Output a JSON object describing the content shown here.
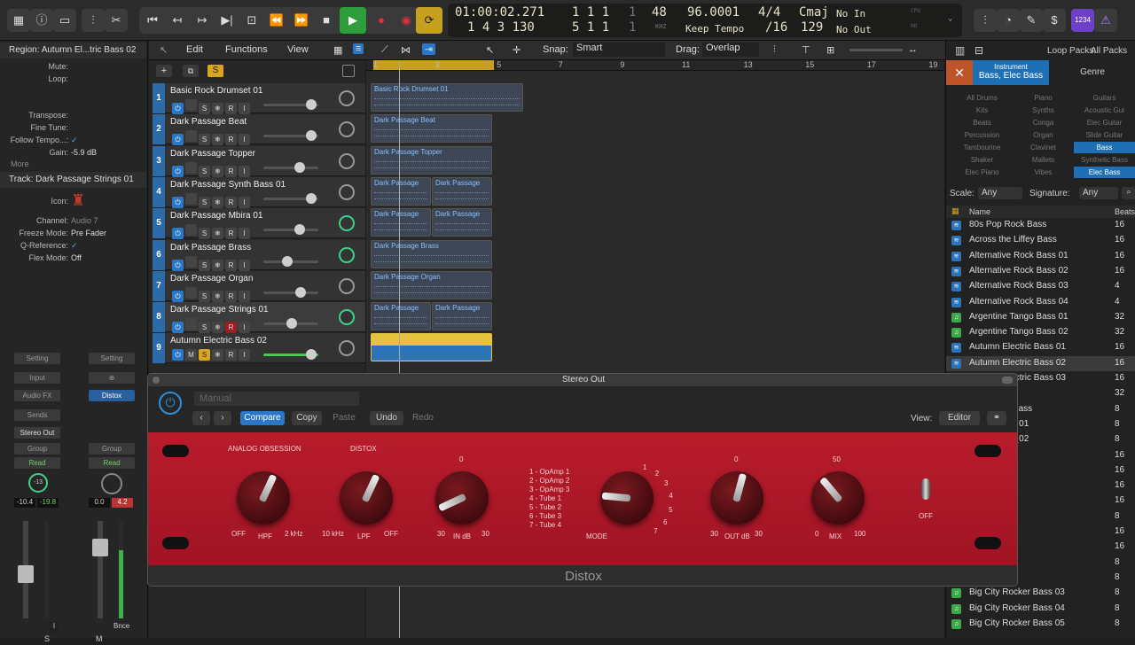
{
  "lcd": {
    "time": "01:00:02.271",
    "bars": "1  1  1",
    "bars_sub": "1",
    "beats": "1  4  3  130",
    "beats2": "5  1  1",
    "beats2_sub": "1",
    "tempo_small": "48",
    "tempo_small_sub": "KHZ",
    "tempo": "96.0001",
    "tempo_mode": "Keep Tempo",
    "sig": "4/4",
    "sig_div": "/16",
    "key": "Cmaj",
    "key_num": "129",
    "in": "No In",
    "out": "No Out",
    "cpu": "CPU",
    "hd": "HD"
  },
  "toolbar": {
    "edit": "Edit",
    "functions": "Functions",
    "view": "View",
    "snap_label": "Snap:",
    "snap": "Smart",
    "drag_label": "Drag:",
    "drag": "Overlap"
  },
  "inspector": {
    "region_title": "Region: Autumn El...tric Bass 02",
    "mute": "Mute:",
    "loop": "Loop:",
    "transpose": "Transpose:",
    "finetune": "Fine Tune:",
    "follow": "Follow Tempo...:",
    "gain_label": "Gain:",
    "gain": "-5.9 dB",
    "more": "More",
    "track_title": "Track:  Dark Passage Strings 01",
    "icon": "Icon:",
    "channel": "Channel:",
    "channel_val": "Audio 7",
    "freeze": "Freeze Mode:",
    "freeze_val": "Pre Fader",
    "qref": "Q-Reference:",
    "flex": "Flex Mode:",
    "flex_val": "Off"
  },
  "strips": [
    {
      "setting": "Setting",
      "input": "Input",
      "fx": "Audio FX",
      "sends": "Sends",
      "out": "Stereo Out",
      "group": "Group",
      "auto": "Read",
      "vol": "-10.4",
      "peak": "-19.8",
      "pan": "-13",
      "mode": "I",
      "bottom": "S"
    },
    {
      "setting": "Setting",
      "input": "",
      "fx": "Distox",
      "sends": "",
      "out": "",
      "group": "Group",
      "auto": "Read",
      "vol": "0.0",
      "peak": "4.2",
      "pan": "",
      "mode": "Bnce",
      "bottom": "M"
    }
  ],
  "tracks": [
    {
      "n": "1",
      "name": "Basic Rock Drumset 01",
      "fader": 0.85
    },
    {
      "n": "2",
      "name": "Dark Passage Beat",
      "fader": 0.85
    },
    {
      "n": "3",
      "name": "Dark Passage Topper",
      "fader": 0.62
    },
    {
      "n": "4",
      "name": "Dark Passage Synth Bass 01",
      "fader": 0.85
    },
    {
      "n": "5",
      "name": "Dark Passage Mbira 01",
      "fader": 0.62
    },
    {
      "n": "6",
      "name": "Dark Passage Brass",
      "fader": 0.37
    },
    {
      "n": "7",
      "name": "Dark Passage Organ",
      "fader": 0.65
    },
    {
      "n": "8",
      "name": "Dark Passage Strings 01",
      "fader": 0.47
    },
    {
      "n": "9",
      "name": "Autumn Electric Bass 02",
      "fader": 0.85
    }
  ],
  "track_buttons": {
    "mute": "M",
    "solo": "S",
    "freeze": "❄",
    "rec": "R",
    "input": "I"
  },
  "ruler": [
    "1",
    "3",
    "5",
    "7",
    "9",
    "11",
    "13",
    "15",
    "17",
    "19"
  ],
  "regions": [
    {
      "row": 0,
      "label": "Basic Rock Drumset 01",
      "x": 5,
      "w": 172
    },
    {
      "row": 1,
      "label": "Dark Passage Beat",
      "x": 5,
      "w": 137
    },
    {
      "row": 2,
      "label": "Dark Passage Topper",
      "x": 5,
      "w": 137
    },
    {
      "row": 3,
      "label": "Dark Passage",
      "x": 5,
      "w": 68
    },
    {
      "row": 3,
      "label": "Dark Passage",
      "x": 74,
      "w": 68
    },
    {
      "row": 4,
      "label": "Dark Passage",
      "x": 5,
      "w": 68
    },
    {
      "row": 4,
      "label": "Dark Passage",
      "x": 74,
      "w": 68
    },
    {
      "row": 5,
      "label": "Dark Passage Brass",
      "x": 5,
      "w": 137
    },
    {
      "row": 6,
      "label": "Dark Passage Organ",
      "x": 5,
      "w": 137
    },
    {
      "row": 7,
      "label": "Dark Passage",
      "x": 5,
      "w": 68
    },
    {
      "row": 7,
      "label": "Dark Passage",
      "x": 74,
      "w": 68
    },
    {
      "row": 8,
      "label": "Autumn Electric Bass 02",
      "x": 5,
      "w": 137,
      "sel": true
    }
  ],
  "browser": {
    "loop_packs_label": "Loop Packs:",
    "loop_packs": "All Packs",
    "tab_instrument": "Instrument",
    "tab_instrument_val": "Bass, Elec Bass",
    "tab_genre": "Genre",
    "categories": [
      "All Drums",
      "Piano",
      "Guitars",
      "Kits",
      "Synths",
      "Acoustic Gui",
      "Beats",
      "Conga",
      "Elec Guitar",
      "Percussion",
      "Organ",
      "Slide Guitar",
      "Tambourine",
      "Clavinet",
      "Bass",
      "Shaker",
      "Mallets",
      "Synthetic Bass",
      "Elec Piano",
      "Vibes",
      "Elec Bass"
    ],
    "scale_label": "Scale:",
    "scale": "Any",
    "sig_label": "Signature:",
    "sig": "Any",
    "col_name": "Name",
    "col_beats": "Beats",
    "loops": [
      {
        "name": "80s Pop Rock Bass",
        "beats": "16",
        "g": false
      },
      {
        "name": "Across the Liffey Bass",
        "beats": "16",
        "g": false
      },
      {
        "name": "Alternative Rock Bass 01",
        "beats": "16",
        "g": false
      },
      {
        "name": "Alternative Rock Bass 02",
        "beats": "16",
        "g": false
      },
      {
        "name": "Alternative Rock Bass 03",
        "beats": "4",
        "g": false
      },
      {
        "name": "Alternative Rock Bass 04",
        "beats": "4",
        "g": false
      },
      {
        "name": "Argentine Tango Bass 01",
        "beats": "32",
        "g": true
      },
      {
        "name": "Argentine Tango Bass 02",
        "beats": "32",
        "g": true
      },
      {
        "name": "Autumn Electric Bass 01",
        "beats": "16",
        "g": false
      },
      {
        "name": "Autumn Electric Bass 02",
        "beats": "16",
        "g": false
      },
      {
        "name": "Autumn Electric Bass 03",
        "beats": "16",
        "g": false
      },
      {
        "name": "ass",
        "beats": "32",
        "g": false
      },
      {
        "name": "ay Electric Bass",
        "beats": "8",
        "g": false
      },
      {
        "name": "ol Sub Bass 01",
        "beats": "8",
        "g": false
      },
      {
        "name": "ol Sub Bass 02",
        "beats": "8",
        "g": false
      },
      {
        "name": "s 01",
        "beats": "16",
        "g": false
      },
      {
        "name": "s 02",
        "beats": "16",
        "g": false
      },
      {
        "name": "s 03",
        "beats": "16",
        "g": false
      },
      {
        "name": "s 04",
        "beats": "16",
        "g": false
      },
      {
        "name": "Bass",
        "beats": "8",
        "g": false
      },
      {
        "name": "lass",
        "beats": "16",
        "g": false
      },
      {
        "name": "lass",
        "beats": "16",
        "g": false
      },
      {
        "name": "ker Bass 01",
        "beats": "8",
        "g": false
      },
      {
        "name": "ker Bass 02",
        "beats": "8",
        "g": false
      },
      {
        "name": "Big City Rocker Bass 03",
        "beats": "8",
        "g": true
      },
      {
        "name": "Big City Rocker Bass 04",
        "beats": "8",
        "g": true
      },
      {
        "name": "Big City Rocker Bass 05",
        "beats": "8",
        "g": true
      }
    ]
  },
  "plugin": {
    "window_title": "Stereo Out",
    "preset": "Manual",
    "compare": "Compare",
    "copy": "Copy",
    "paste": "Paste",
    "undo": "Undo",
    "redo": "Redo",
    "view_label": "View:",
    "view": "Editor",
    "brand1": "ANALOG OBSESSION",
    "brand2": "DISTOX",
    "name": "Distox",
    "hpf_off": "OFF",
    "hpf": "HPF",
    "hpf_max": "2 kHz",
    "lpf_min": "10 kHz",
    "lpf": "LPF",
    "lpf_off": "OFF",
    "in_min": "30",
    "in": "IN dB",
    "in_max": "30",
    "in_zero": "0",
    "modes": [
      "1 - OpAmp 1",
      "2 - OpAmp 2",
      "3 - OpAmp 3",
      "4 - Tube 1",
      "5 - Tube 2",
      "6 - Tube 3",
      "7 - Tube 4"
    ],
    "mode": "MODE",
    "mode_ticks": [
      "1",
      "2",
      "3",
      "4",
      "5",
      "6",
      "7"
    ],
    "out_min": "30",
    "out": "OUT dB",
    "out_max": "30",
    "out_zero": "0",
    "mix_min": "0",
    "mix": "MIX",
    "mix_max": "100",
    "mix_mid": "50",
    "switch_off": "OFF"
  }
}
